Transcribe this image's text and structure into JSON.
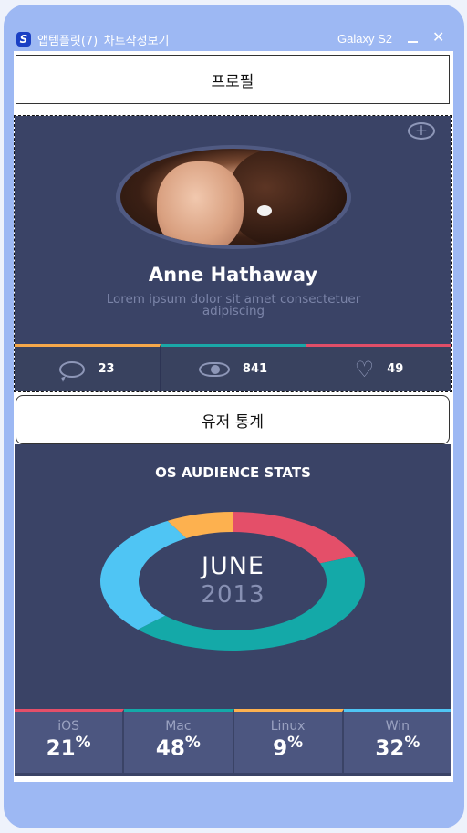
{
  "window": {
    "app_title": "앱템플릿(7)_차트작성보기",
    "device": "Galaxy S2",
    "app_icon_letter": "S",
    "minimize_icon": "minimize-icon",
    "close_glyph": "✕"
  },
  "sections": {
    "profile_label": "프로필",
    "user_stats_label": "유저 통계"
  },
  "profile": {
    "name": "Anne Hathaway",
    "description": "Lorem ipsum dolor sit amet consectetuer adipiscing",
    "add_glyph": "+",
    "stats": [
      {
        "icon": "comment-icon",
        "value": "23",
        "color": "#f6a84a"
      },
      {
        "icon": "eye-icon",
        "value": "841",
        "color": "#1aa7a7"
      },
      {
        "icon": "heart-icon",
        "value": "49",
        "color": "#e04e68"
      }
    ]
  },
  "os_stats": {
    "title": "OS AUDIENCE STATS",
    "month": "JUNE",
    "year": "2013"
  },
  "chart_data": {
    "type": "pie",
    "title": "OS AUDIENCE STATS",
    "categories": [
      "iOS",
      "Mac",
      "Linux",
      "Win"
    ],
    "values": [
      21,
      48,
      9,
      32
    ],
    "unit": "%",
    "colors": [
      "#e44f69",
      "#14a9a8",
      "#fdb14f",
      "#4fc5f4"
    ],
    "ring_order": [
      "iOS",
      "Mac",
      "Win",
      "Linux"
    ]
  },
  "colors": {
    "card_bg": "#3a4366",
    "frame": "#9db8f3"
  }
}
